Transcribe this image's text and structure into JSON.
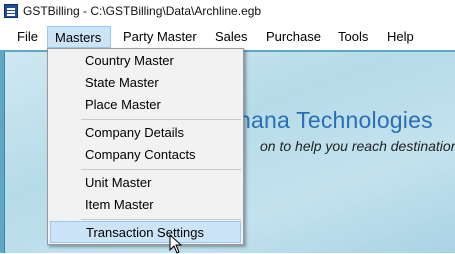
{
  "window": {
    "title": "GSTBilling - C:\\GSTBilling\\Data\\Archline.egb"
  },
  "menubar": {
    "items": [
      "File",
      "Masters",
      "Party Master",
      "Sales",
      "Purchase",
      "Tools",
      "Help"
    ],
    "active": "Masters"
  },
  "masters_menu": {
    "items": [
      "Country Master",
      "State Master",
      "Place Master",
      "Company Details",
      "Company Contacts",
      "Unit Master",
      "Item Master",
      "Transaction Settings"
    ],
    "highlighted": "Transaction Settings"
  },
  "background": {
    "brand_title": "hana Technologies",
    "brand_subtitle": "on to help you reach destination"
  },
  "colors": {
    "highlight": "#cce4f7",
    "highlight_border": "#99c9ef",
    "brand": "#2a6fb6"
  }
}
